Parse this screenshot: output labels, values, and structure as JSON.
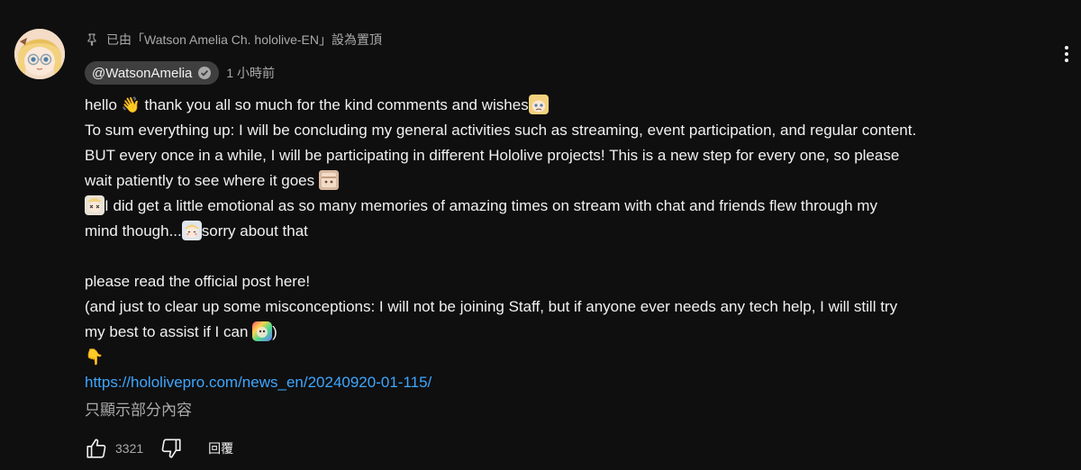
{
  "pinned_text": "已由「Watson Amelia Ch. hololive-EN」設為置頂",
  "author": {
    "handle": "@WatsonAmelia",
    "time": "1 小時前"
  },
  "content": {
    "line1_a": "hello ",
    "line1_b": " thank you all so much for the kind comments and wishes",
    "line2": "To sum everything up: I will be concluding my general activities such as streaming, event participation, and regular content.",
    "line3": "BUT every once in a while, I will be participating in different Hololive projects! This is a new step for every one, so please",
    "line4": "wait patiently to see where it goes ",
    "line5": "I did get a little emotional as so many memories of amazing times on stream with chat and friends flew through my",
    "line6_a": "mind though...",
    "line6_b": "sorry about that",
    "line7": "please read the official post here!",
    "line8": "(and just to clear up some misconceptions: I will not be joining Staff, but if anyone ever needs any tech help, I will still try",
    "line9_a": "my best to assist if I can ",
    "line9_b": ")",
    "link": "https://hololivepro.com/news_en/20240920-01-115/"
  },
  "show_less": "只顯示部分內容",
  "actions": {
    "like_count": "3321",
    "reply": "回覆"
  },
  "icons": {
    "pin": "pin-icon",
    "verified": "verified-check-icon",
    "like": "thumbs-up-icon",
    "dislike": "thumbs-down-icon",
    "menu": "more-vert-icon",
    "wave": "waving-hand-emoji",
    "point_down": "pointing-down-emoji"
  },
  "colors": {
    "background": "#0f0f0f",
    "text": "#f1f1f1",
    "secondary": "#aaaaaa",
    "link": "#3ea6ff",
    "chip": "#3f3f3f"
  }
}
